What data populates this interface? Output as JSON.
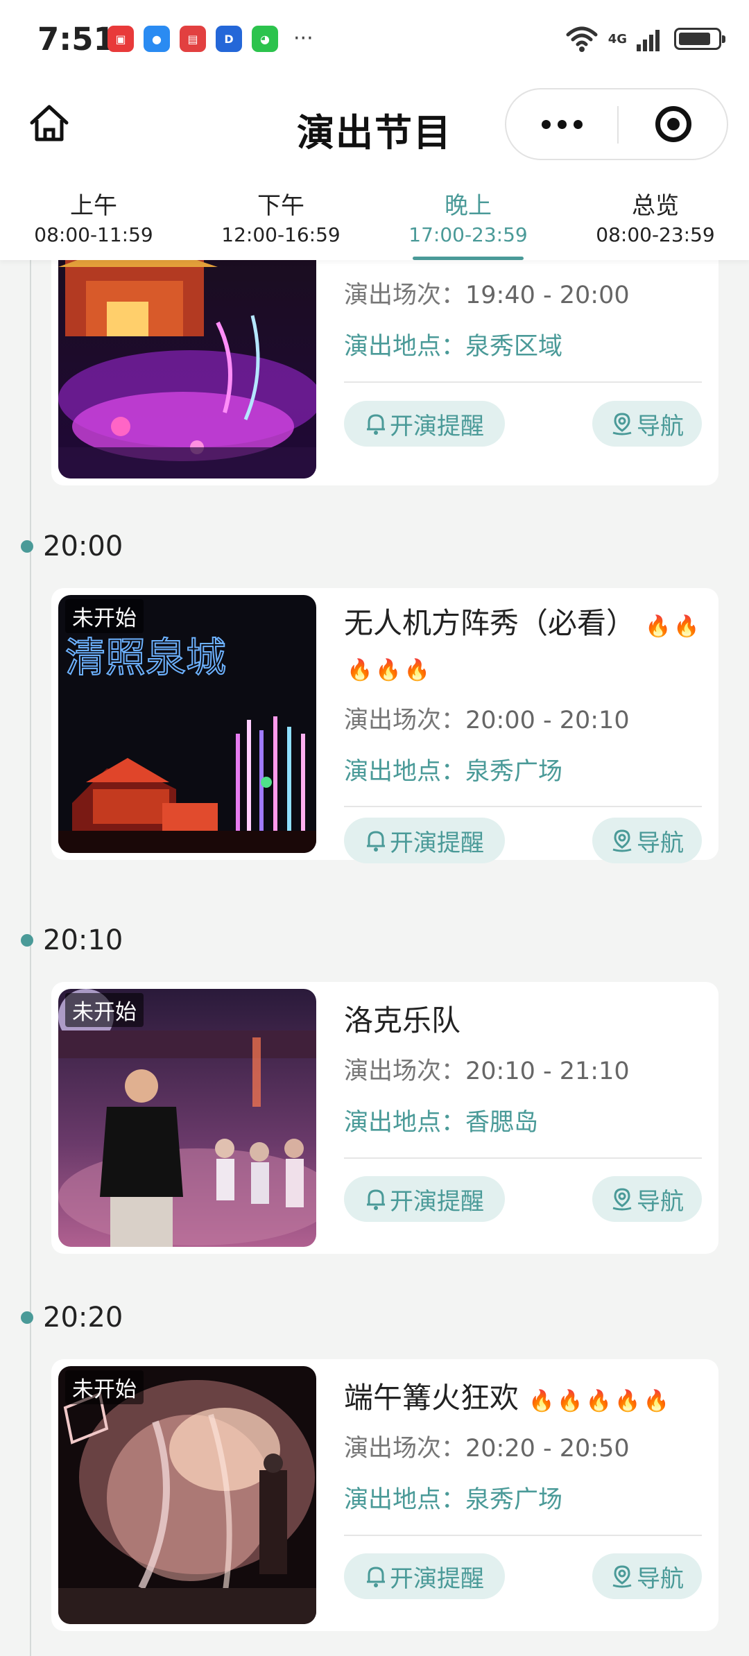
{
  "status_bar": {
    "time": "7:51",
    "network": "4G",
    "battery_level_pct": 85,
    "notification_apps": [
      {
        "icon": "huawei-store-icon",
        "color": "#e83a3a"
      },
      {
        "icon": "messages-icon",
        "color": "#2a8bf2"
      },
      {
        "icon": "reader-icon",
        "color": "#e24040"
      },
      {
        "icon": "d-app-icon",
        "color": "#2467d8"
      },
      {
        "icon": "wechat-icon",
        "color": "#2cc34d"
      }
    ],
    "more": "···"
  },
  "header": {
    "title": "演出节目",
    "home_icon": "home-icon",
    "more_icon": "more-dots-icon",
    "close_icon": "target-close-icon"
  },
  "tabs": [
    {
      "name": "上午",
      "range": "08:00-11:59",
      "active": false
    },
    {
      "name": "下午",
      "range": "12:00-16:59",
      "active": false
    },
    {
      "name": "晚上",
      "range": "17:00-23:59",
      "active": true
    },
    {
      "name": "总览",
      "range": "08:00-23:59",
      "active": false
    }
  ],
  "labels": {
    "session": "演出场次：",
    "location": "演出地点：",
    "remind": "开演提醒",
    "navigate": "导航",
    "not_started": "未开始"
  },
  "events": [
    {
      "time": "",
      "title": "",
      "flames": 0,
      "session": "19:40 - 20:00",
      "location": "泉秀区域",
      "status": ""
    },
    {
      "time": "20:00",
      "title": "无人机方阵秀（必看）",
      "flames": 5,
      "session": "20:00 - 20:10",
      "location": "泉秀广场",
      "status": "未开始",
      "image_text": "清照泉城"
    },
    {
      "time": "20:10",
      "title": "洛克乐队",
      "flames": 0,
      "session": "20:10 - 21:10",
      "location": "香腮岛",
      "status": "未开始"
    },
    {
      "time": "20:20",
      "title": "端午篝火狂欢",
      "flames": 5,
      "session": "20:20 - 20:50",
      "location": "泉秀广场",
      "status": "未开始"
    }
  ],
  "colors": {
    "accent": "#4a9a98",
    "accent_bg": "#e2f0ef",
    "flame": "#e8563a",
    "page_bg": "#f3f4f3"
  }
}
